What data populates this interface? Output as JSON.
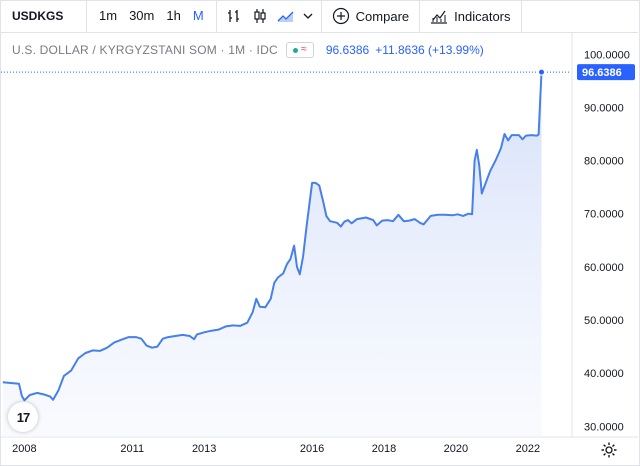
{
  "toolbar": {
    "symbol": "USDKGS",
    "intervals": [
      {
        "label": "1m",
        "active": false
      },
      {
        "label": "30m",
        "active": false
      },
      {
        "label": "1h",
        "active": false
      },
      {
        "label": "M",
        "active": true
      }
    ],
    "compare_label": "Compare",
    "indicators_label": "Indicators"
  },
  "legend": {
    "title": "U.S. DOLLAR / KYRGYZSTANI SOM · 1M · IDC",
    "value": "96.6386",
    "change": "+11.8636 (+13.99%)"
  },
  "price_label": "96.6386",
  "logo_text": "17",
  "colors": {
    "line": "#4680e8",
    "accent": "#2962ff",
    "fill": "#dfe8fb"
  },
  "chart_data": {
    "type": "area",
    "title": "U.S. DOLLAR / KYRGYZSTANI SOM · 1M · IDC",
    "ylim": [
      28,
      104
    ],
    "xlim": [
      2007.35,
      2023.2
    ],
    "y_ticks": [
      "100.0000",
      "90.0000",
      "80.0000",
      "70.0000",
      "60.0000",
      "50.0000",
      "40.0000",
      "30.0000"
    ],
    "x_ticks": [
      "2008",
      "2011",
      "2013",
      "2016",
      "2018",
      "2020",
      "2022"
    ],
    "grid": false,
    "last_value": 96.6386,
    "points": [
      [
        2007.4,
        38.3
      ],
      [
        2007.7,
        38.1
      ],
      [
        2007.85,
        38.0
      ],
      [
        2007.93,
        35.7
      ],
      [
        2008.0,
        34.9
      ],
      [
        2008.15,
        35.9
      ],
      [
        2008.35,
        36.3
      ],
      [
        2008.55,
        36.0
      ],
      [
        2008.72,
        35.6
      ],
      [
        2008.8,
        35.0
      ],
      [
        2008.95,
        36.8
      ],
      [
        2009.1,
        39.5
      ],
      [
        2009.3,
        40.5
      ],
      [
        2009.5,
        42.8
      ],
      [
        2009.7,
        43.8
      ],
      [
        2009.9,
        44.3
      ],
      [
        2010.1,
        44.2
      ],
      [
        2010.3,
        44.8
      ],
      [
        2010.5,
        45.8
      ],
      [
        2010.7,
        46.3
      ],
      [
        2010.9,
        46.8
      ],
      [
        2011.1,
        46.8
      ],
      [
        2011.25,
        46.5
      ],
      [
        2011.4,
        45.2
      ],
      [
        2011.55,
        44.8
      ],
      [
        2011.7,
        45.0
      ],
      [
        2011.85,
        46.5
      ],
      [
        2012.0,
        46.8
      ],
      [
        2012.2,
        47.0
      ],
      [
        2012.4,
        47.2
      ],
      [
        2012.6,
        47.0
      ],
      [
        2012.72,
        46.4
      ],
      [
        2012.8,
        47.3
      ],
      [
        2013.0,
        47.7
      ],
      [
        2013.2,
        48.0
      ],
      [
        2013.4,
        48.2
      ],
      [
        2013.6,
        48.8
      ],
      [
        2013.8,
        49.0
      ],
      [
        2014.0,
        48.9
      ],
      [
        2014.2,
        49.5
      ],
      [
        2014.35,
        51.5
      ],
      [
        2014.45,
        54.0
      ],
      [
        2014.55,
        52.5
      ],
      [
        2014.7,
        52.4
      ],
      [
        2014.85,
        54.0
      ],
      [
        2014.95,
        57.0
      ],
      [
        2015.05,
        58.0
      ],
      [
        2015.2,
        58.8
      ],
      [
        2015.3,
        60.5
      ],
      [
        2015.4,
        61.5
      ],
      [
        2015.5,
        64.0
      ],
      [
        2015.58,
        60.0
      ],
      [
        2015.66,
        58.6
      ],
      [
        2015.75,
        62.0
      ],
      [
        2015.85,
        67.8
      ],
      [
        2015.92,
        71.5
      ],
      [
        2016.0,
        75.8
      ],
      [
        2016.1,
        75.8
      ],
      [
        2016.2,
        75.3
      ],
      [
        2016.3,
        72.5
      ],
      [
        2016.4,
        69.5
      ],
      [
        2016.5,
        68.6
      ],
      [
        2016.7,
        68.3
      ],
      [
        2016.8,
        67.6
      ],
      [
        2016.9,
        68.5
      ],
      [
        2017.0,
        68.8
      ],
      [
        2017.1,
        68.2
      ],
      [
        2017.25,
        69.0
      ],
      [
        2017.5,
        69.3
      ],
      [
        2017.7,
        68.8
      ],
      [
        2017.8,
        67.8
      ],
      [
        2017.95,
        68.7
      ],
      [
        2018.1,
        68.8
      ],
      [
        2018.25,
        68.6
      ],
      [
        2018.4,
        69.8
      ],
      [
        2018.55,
        68.6
      ],
      [
        2018.7,
        68.7
      ],
      [
        2018.85,
        69.0
      ],
      [
        2019.0,
        68.3
      ],
      [
        2019.1,
        68.0
      ],
      [
        2019.3,
        69.6
      ],
      [
        2019.5,
        69.8
      ],
      [
        2019.7,
        69.8
      ],
      [
        2019.9,
        69.7
      ],
      [
        2020.05,
        69.9
      ],
      [
        2020.2,
        69.6
      ],
      [
        2020.35,
        70.0
      ],
      [
        2020.45,
        69.9
      ],
      [
        2020.52,
        80.0
      ],
      [
        2020.58,
        82.0
      ],
      [
        2020.65,
        79.0
      ],
      [
        2020.72,
        73.8
      ],
      [
        2020.8,
        75.3
      ],
      [
        2020.95,
        78.0
      ],
      [
        2021.1,
        80.0
      ],
      [
        2021.25,
        82.3
      ],
      [
        2021.35,
        85.0
      ],
      [
        2021.45,
        83.8
      ],
      [
        2021.55,
        84.8
      ],
      [
        2021.75,
        84.8
      ],
      [
        2021.85,
        84.0
      ],
      [
        2021.95,
        84.7
      ],
      [
        2022.1,
        84.8
      ],
      [
        2022.25,
        84.7
      ],
      [
        2022.3,
        84.9
      ],
      [
        2022.38,
        96.6386
      ]
    ]
  }
}
